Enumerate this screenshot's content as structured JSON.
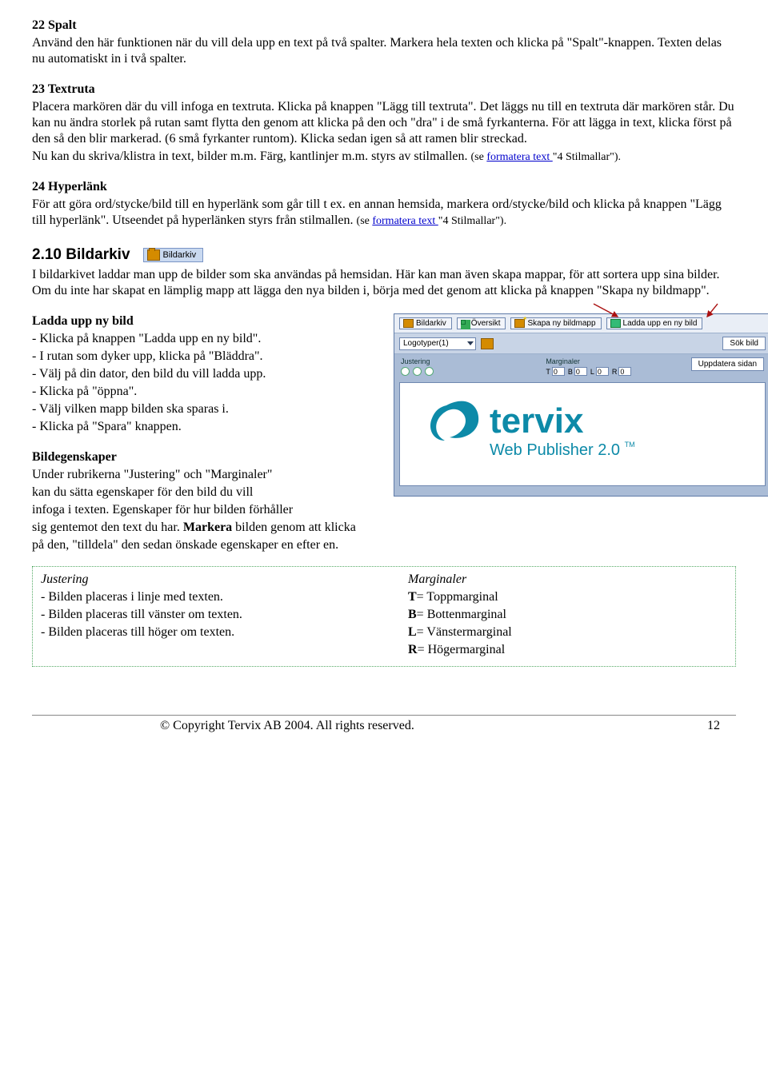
{
  "s22": {
    "head": "22 Spalt",
    "body": "Använd den här funktionen när du vill dela upp en text på två spalter. Markera hela texten och klicka på \"Spalt\"-knappen. Texten delas nu automatiskt in i två spalter."
  },
  "s23": {
    "head": "23 Textruta",
    "body1": "Placera markören där du vill infoga en textruta. Klicka på knappen \"Lägg till textruta\". Det läggs nu till en textruta där markören står. Du kan nu ändra storlek på rutan samt flytta den genom att klicka på den och \"dra\" i de små fyrkanterna. För att lägga in text, klicka först på den så den blir markerad. (6 små fyrkanter runtom). Klicka sedan igen så att ramen blir streckad.",
    "body2a": "Nu kan du skriva/klistra in text, bilder m.m. Färg, kantlinjer m.m. styrs av stilmallen. ",
    "body2b_small_pre": "(se ",
    "body2b_link": "formatera text ",
    "body2b_small_post": " \"4 Stilmallar\")."
  },
  "s24": {
    "head": "24 Hyperlänk",
    "body": "För att göra ord/stycke/bild till en hyperlänk som går till t ex. en annan hemsida, markera ord/stycke/bild och klicka på knappen \"Lägg till hyperlänk\". Utseendet på hyperlänken styrs från stilmallen. ",
    "body_small_pre": "(se ",
    "body_link": "formatera text ",
    "body_small_post": " \"4 Stilmallar\")."
  },
  "h210": {
    "title": "2.10  Bildarkiv",
    "btn": "Bildarkiv",
    "body": "I bildarkivet laddar man upp de bilder som ska användas på hemsidan. Här kan man även skapa mappar, för att sortera upp sina bilder. Om du inte har skapat en lämplig mapp att lägga den nya bilden i, börja med det genom att klicka på knappen \"Skapa ny bildmapp\"."
  },
  "ladda": {
    "head": "Ladda upp ny bild",
    "i1": "- Klicka på knappen \"Ladda upp en ny bild\".",
    "i2": "- I rutan som dyker upp, klicka på \"Bläddra\".",
    "i3": "- Välj på din dator, den bild du vill ladda upp.",
    "i4": "- Klicka på \"öppna\".",
    "i5": "- Välj vilken mapp bilden ska sparas i.",
    "i6": "- Klicka på \"Spara\" knappen."
  },
  "panel": {
    "btn1": "Bildarkiv",
    "btn2": "Översikt",
    "btn3": "Skapa ny bildmapp",
    "btn4": "Ladda upp en ny bild",
    "select": "Logotyper(1)",
    "sok": "Sök bild",
    "j": "Justering",
    "m": "Marginaler",
    "mT": "T",
    "mB": "B",
    "mL": "L",
    "mR": "R",
    "mval": "0",
    "upd": "Uppdatera sidan",
    "logo_line1": "tervix",
    "logo_line2": "Web Publisher 2.0",
    "logo_tm": "TM"
  },
  "bildeg": {
    "head": "Bildegenskaper",
    "l1": "Under rubrikerna \"Justering\" och \"Marginaler\"",
    "l2": "kan du sätta egenskaper för den bild du vill",
    "l3": "infoga i texten. Egenskaper för hur bilden förhåller",
    "l4a": "sig gentemot den text du har. ",
    "l4b_bold": "Markera",
    "l4c": " bilden genom att klicka",
    "l5": "på den, \"tilldela\" den sedan önskade egenskaper en efter en."
  },
  "box": {
    "left_head": "Justering",
    "l1": "- Bilden placeras i linje med texten.",
    "l2": "- Bilden placeras till vänster om texten.",
    "l3": "- Bilden placeras till höger om texten.",
    "right_head": "Marginaler",
    "r1b": "T",
    "r1": "= Toppmarginal",
    "r2b": "B",
    "r2": "= Bottenmarginal",
    "r3b": "L",
    "r3": "= Vänstermarginal",
    "r4b": "R",
    "r4": "= Högermarginal"
  },
  "footer": {
    "copy": "© Copyright Tervix AB 2004. All rights reserved.",
    "page": "12"
  }
}
